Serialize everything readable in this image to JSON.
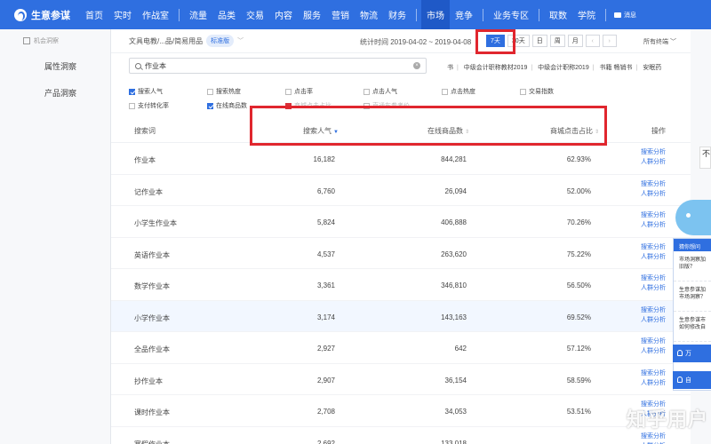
{
  "brand": {
    "name": "生意参谋"
  },
  "nav": {
    "left": [
      "首页",
      "实时",
      "作战室"
    ],
    "mid": [
      "流量",
      "品类",
      "交易",
      "内容",
      "服务",
      "营销",
      "物流",
      "财务"
    ],
    "right_active": "市场",
    "right": [
      "竞争"
    ],
    "extra": [
      "业务专区"
    ],
    "tail": [
      "取数",
      "学院"
    ],
    "message": "消息"
  },
  "sidebar": {
    "section": "机会洞察",
    "items": [
      "属性洞察",
      "产品洞察"
    ]
  },
  "filter": {
    "breadcrumb": "文具电教/...品/简易用品",
    "badge": "标准版",
    "stat_time": "统计时间 2019-04-02 ~ 2019-04-08",
    "periods": [
      "7天",
      "30天",
      "日",
      "周",
      "月"
    ],
    "all_terminals": "所有终端"
  },
  "search": {
    "value": "作业本",
    "suggestions": [
      "书",
      "中级会计职称教材2019",
      "中级会计职称2019",
      "书籍 畅销书",
      "安眠药"
    ]
  },
  "metrics": [
    {
      "label": "搜索人气",
      "checked": true
    },
    {
      "label": "搜索热度",
      "checked": false
    },
    {
      "label": "点击率",
      "checked": false
    },
    {
      "label": "点击人气",
      "checked": false
    },
    {
      "label": "点击热度",
      "checked": false
    },
    {
      "label": "交易指数",
      "checked": false
    },
    {
      "label": "支付转化率",
      "checked": false
    },
    {
      "label": "在线商品数",
      "checked": true
    },
    {
      "label": "商城点击占比",
      "checked": true,
      "color": "#d8323a"
    },
    {
      "label": "直通车参考价",
      "checked": false
    }
  ],
  "table": {
    "headers": {
      "keyword": "搜索词",
      "popularity": "搜索人气",
      "products": "在线商品数",
      "mall_ratio": "商城点击占比",
      "ops": "操作"
    },
    "ops": [
      "搜索分析",
      "人群分析"
    ],
    "rows": [
      {
        "keyword": "作业本",
        "popularity": "16,182",
        "products": "844,281",
        "mall_ratio": "62.93%"
      },
      {
        "keyword": "记作业本",
        "popularity": "6,760",
        "products": "26,094",
        "mall_ratio": "52.00%"
      },
      {
        "keyword": "小学生作业本",
        "popularity": "5,824",
        "products": "406,888",
        "mall_ratio": "70.26%"
      },
      {
        "keyword": "英语作业本",
        "popularity": "4,537",
        "products": "263,620",
        "mall_ratio": "75.22%"
      },
      {
        "keyword": "数学作业本",
        "popularity": "3,361",
        "products": "346,810",
        "mall_ratio": "56.50%"
      },
      {
        "keyword": "小学作业本",
        "popularity": "3,174",
        "products": "143,163",
        "mall_ratio": "69.52%"
      },
      {
        "keyword": "全品作业本",
        "popularity": "2,927",
        "products": "642",
        "mall_ratio": "57.12%"
      },
      {
        "keyword": "抄作业本",
        "popularity": "2,907",
        "products": "36,154",
        "mall_ratio": "58.59%"
      },
      {
        "keyword": "课时作业本",
        "popularity": "2,708",
        "products": "34,053",
        "mall_ratio": "53.51%"
      },
      {
        "keyword": "寒假作业本",
        "popularity": "2,692",
        "products": "133,018",
        "mall_ratio": ""
      }
    ]
  },
  "right_panel": {
    "card": "不",
    "header": "猜你想问",
    "questions": [
      "市场洞察加\n旧版？",
      "生意参谋加\n市场洞察？",
      "生意参谋市\n如何修改自"
    ],
    "bar1": "万",
    "bar2": "自"
  },
  "watermark": "知乎用户"
}
